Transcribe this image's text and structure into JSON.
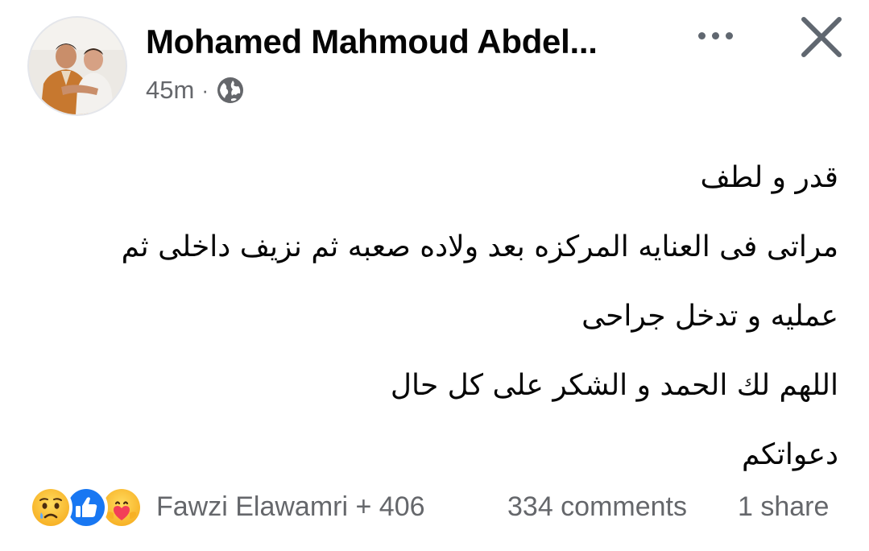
{
  "post": {
    "author_name": "Mohamed Mahmoud Abdel...",
    "timestamp": "45m",
    "separator": "·",
    "audience_icon": "globe-icon",
    "more_icon": "more-dots-icon",
    "close_icon": "close-icon",
    "body_lines": [
      "قدر و لطف",
      "مراتى فى العنايه المركزه بعد ولاده صعبه ثم نزيف داخلى ثم",
      "عمليه و تدخل جراحى",
      "اللهم لك الحمد و الشكر على كل حال",
      "دعواتكم"
    ]
  },
  "footer": {
    "reaction_icons": [
      "sad-reaction-icon",
      "like-reaction-icon",
      "care-reaction-icon"
    ],
    "reactors_text": "Fawzi Elawamri + 406",
    "comments_text": "334 comments",
    "shares_text": "1 share"
  },
  "colors": {
    "primary_text": "#050505",
    "secondary_text": "#65676b",
    "like_blue": "#1877f2",
    "reaction_yellow": "#f7b125",
    "care_red": "#f33e58",
    "background": "#ffffff"
  }
}
